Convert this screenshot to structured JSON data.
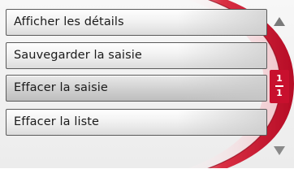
{
  "menu": {
    "items": [
      {
        "label": "Afficher les détails"
      },
      {
        "label": "Sauvegarder la saisie"
      },
      {
        "label": "Effacer la saisie"
      },
      {
        "label": "Effacer la liste"
      }
    ],
    "active_index": 2
  },
  "pager": {
    "current": "1",
    "total": "1"
  },
  "icons": {
    "up": "triangle-up-icon",
    "down": "triangle-down-icon"
  },
  "colors": {
    "accent": "#c8102e",
    "arc": "#d8253a"
  }
}
